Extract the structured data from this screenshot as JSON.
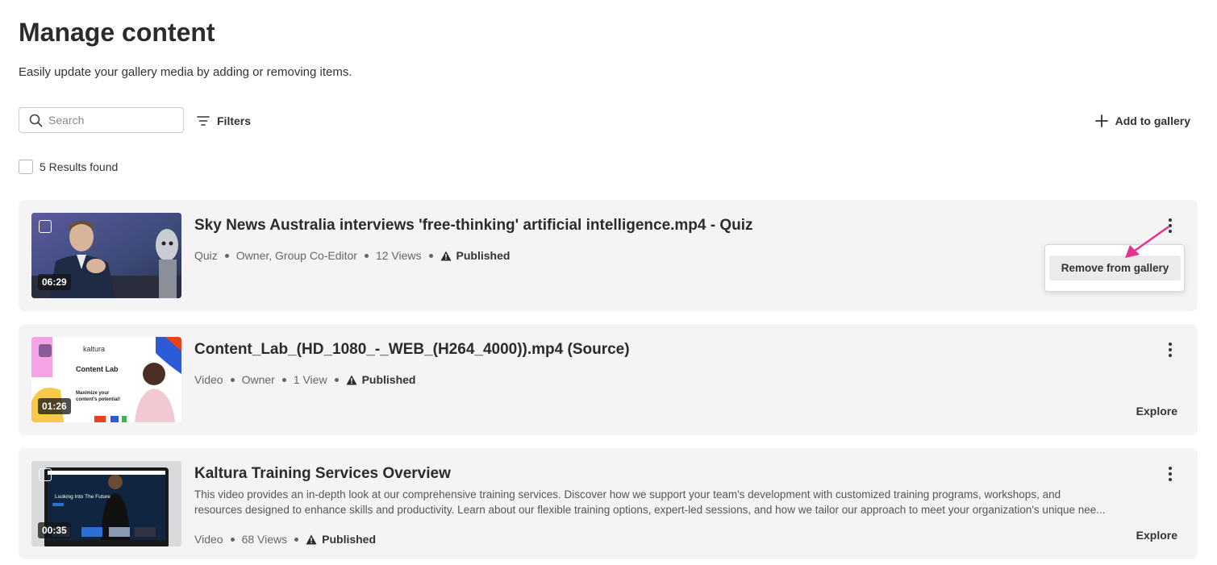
{
  "header": {
    "title": "Manage content",
    "subtitle": "Easily update your gallery media by adding or removing items."
  },
  "toolbar": {
    "search_placeholder": "Search",
    "search_value": "",
    "filters_label": "Filters",
    "add_label": "Add to gallery"
  },
  "results": {
    "count_label": "5 Results found"
  },
  "entries": [
    {
      "title": "Sky News Australia interviews 'free-thinking' artificial intelligence.mp4 - Quiz",
      "duration": "06:29",
      "meta": [
        "Quiz",
        "Owner, Group Co-Editor",
        "12 Views"
      ],
      "status": "Published",
      "thumb_icon": "interview-thumbnail"
    },
    {
      "title": "Content_Lab_(HD_1080_-_WEB_(H264_4000)).mp4 (Source)",
      "duration": "01:26",
      "meta": [
        "Video",
        "Owner",
        "1 View"
      ],
      "status": "Published",
      "explore_label": "Explore",
      "thumb_icon": "content-lab-thumbnail",
      "thumb_text": {
        "brand": "kaltura",
        "heading": "Content Lab",
        "line1": "Maximize your",
        "line2": "content's potential!"
      }
    },
    {
      "title": "Kaltura Training Services Overview",
      "duration": "00:35",
      "description_line1": "This video provides an in-depth look at our comprehensive training services. Discover how we support your team's development with customized training programs, workshops, and",
      "description_line2": "resources designed to enhance skills and productivity. Learn about our flexible training options, expert-led sessions, and how we tailor our approach to meet your organization's unique nee...",
      "meta": [
        "Video",
        "68 Views"
      ],
      "status": "Published",
      "explore_label": "Explore",
      "thumb_icon": "training-thumbnail",
      "thumb_text": {
        "heading": "Looking Into The Future"
      }
    }
  ],
  "context_menu": {
    "remove_label": "Remove from gallery"
  },
  "colors": {
    "card_bg": "#f4f4f4",
    "arrow": "#e8318a",
    "text_dark": "#2b2b2b"
  }
}
